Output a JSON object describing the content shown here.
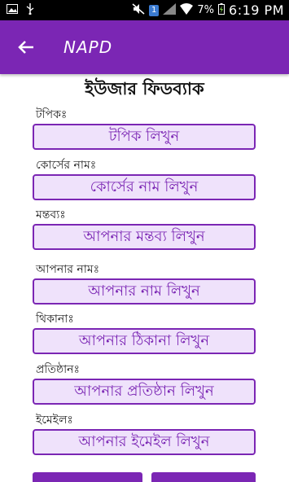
{
  "status_bar": {
    "battery_percent": "7%",
    "time": "6:19 PM",
    "sim": "1"
  },
  "app_bar": {
    "title": "NAPD"
  },
  "form": {
    "title": "ইউজার ফিডব্যাক",
    "fields": [
      {
        "label": "টপিকঃ",
        "placeholder": "টপিক লিখুন"
      },
      {
        "label": "কোর্সের নামঃ",
        "placeholder": "কোর্সের নাম লিখুন"
      },
      {
        "label": "মন্তব্যঃ",
        "placeholder": "আপনার মন্তব্য লিখুন"
      },
      {
        "label": "আপনার নামঃ",
        "placeholder": "আপনার নাম লিখুন"
      },
      {
        "label": "থিকানাঃ",
        "placeholder": "আপনার ঠিকানা লিখুন"
      },
      {
        "label": "প্রতিষ্ঠানঃ",
        "placeholder": "আপনার প্রতিষ্ঠান লিখুন"
      },
      {
        "label": "ইমেইলঃ",
        "placeholder": "আপনার ইমেইল লিখুন"
      }
    ]
  },
  "colors": {
    "primary": "#7b26b4",
    "field_bg": "#efe2fb"
  }
}
